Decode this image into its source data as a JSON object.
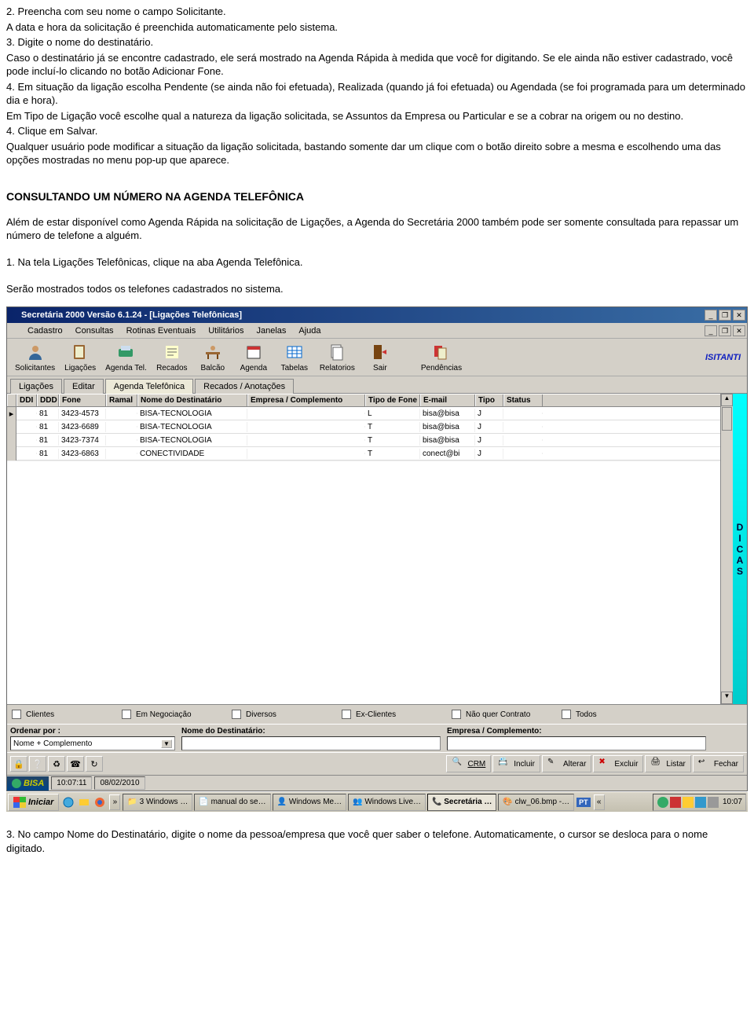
{
  "doc": {
    "p1": "2. Preencha com seu nome o campo Solicitante.",
    "p2": "A data e hora da solicitação é preenchida automaticamente pelo sistema.",
    "p3": "3. Digite o nome do destinatário.",
    "p4": "Caso o destinatário já se encontre cadastrado, ele será mostrado na Agenda Rápida à medida que você for digitando. Se ele ainda não estiver cadastrado, você pode incluí-lo clicando no botão Adicionar Fone.",
    "p5": "4. Em situação da ligação escolha Pendente (se ainda não foi efetuada), Realizada (quando já foi efetuada) ou Agendada (se foi programada para um determinado dia e hora).",
    "p6": "Em Tipo de Ligação você escolhe qual a natureza da ligação solicitada, se Assuntos da Empresa ou Particular e se a cobrar na origem ou no destino.",
    "p7": "4. Clique em Salvar.",
    "p8": "Qualquer usuário pode modificar a situação da ligação solicitada, bastando somente dar um clique com o botão direito sobre a mesma e escolhendo uma das opções mostradas no menu pop-up que aparece.",
    "heading": "CONSULTANDO UM NÚMERO NA AGENDA TELEFÔNICA",
    "p9": "Além de estar disponível como Agenda Rápida na solicitação de Ligações, a Agenda do Secretária 2000 também pode ser somente consultada para repassar um número de telefone a alguém.",
    "p10": "1. Na tela Ligações Telefônicas, clique na aba Agenda Telefônica.",
    "p11": "Serão mostrados todos os telefones cadastrados no sistema.",
    "p12": "3. No campo Nome do Destinatário, digite o nome da pessoa/empresa que você quer saber o telefone. Automaticamente, o cursor se desloca para o nome digitado."
  },
  "app": {
    "title": "Secretária 2000 Versão 6.1.24 - [Ligações Telefônicas]",
    "menus": [
      "Cadastro",
      "Consultas",
      "Rotinas Eventuais",
      "Utilitários",
      "Janelas",
      "Ajuda"
    ],
    "toolbar": [
      "Solicitantes",
      "Ligações",
      "Agenda Tel.",
      "Recados",
      "Balcão",
      "Agenda",
      "Tabelas",
      "Relatorios",
      "Sair",
      "Pendências"
    ],
    "marquee": "ISITANTI",
    "tabs": [
      "Ligações",
      "Editar",
      "Agenda Telefônica",
      "Recados / Anotações"
    ],
    "active_tab": 2,
    "grid": {
      "headers": [
        "DDI",
        "DDD",
        "Fone",
        "Ramal",
        "Nome do Destinatário",
        "Empresa / Complemento",
        "Tipo de Fone",
        "E-mail",
        "Tipo",
        "Status"
      ],
      "widths": [
        26,
        28,
        60,
        40,
        140,
        150,
        70,
        70,
        36,
        50
      ],
      "rows": [
        {
          "ddi": "",
          "ddd": "81",
          "fone": "3423-4573",
          "ramal": "",
          "nome": "BISA-TECNOLOGIA",
          "empresa": "",
          "tipofone": "L",
          "email": "bisa@bisa",
          "tipo": "J",
          "status": ""
        },
        {
          "ddi": "",
          "ddd": "81",
          "fone": "3423-6689",
          "ramal": "",
          "nome": "BISA-TECNOLOGIA",
          "empresa": "",
          "tipofone": "T",
          "email": "bisa@bisa",
          "tipo": "J",
          "status": ""
        },
        {
          "ddi": "",
          "ddd": "81",
          "fone": "3423-7374",
          "ramal": "",
          "nome": "BISA-TECNOLOGIA",
          "empresa": "",
          "tipofone": "T",
          "email": "bisa@bisa",
          "tipo": "J",
          "status": ""
        },
        {
          "ddi": "",
          "ddd": "81",
          "fone": "3423-6863",
          "ramal": "",
          "nome": "CONECTIVIDADE",
          "empresa": "",
          "tipofone": "T",
          "email": "conect@bi",
          "tipo": "J",
          "status": ""
        }
      ]
    },
    "dicas": "DICAS",
    "checks": [
      "Clientes",
      "Em Negociação",
      "Diversos",
      "Ex-Clientes",
      "Não quer Contrato",
      "Todos"
    ],
    "filters": {
      "ordenar_label": "Ordenar por :",
      "ordenar_value": "Nome + Complemento",
      "nome_label": "Nome do Destinatário:",
      "nome_value": "",
      "empresa_label": "Empresa / Complemento:",
      "empresa_value": ""
    },
    "buttons": {
      "crm": "CRM",
      "incluir": "Incluir",
      "alterar": "Alterar",
      "excluir": "Excluir",
      "listar": "Listar",
      "fechar": "Fechar"
    },
    "status": {
      "time": "10:07:11",
      "date": "08/02/2010",
      "bisa": "BISA"
    },
    "taskbar": {
      "start": "Iniciar",
      "items": [
        "3 Windows …",
        "manual do se…",
        "Windows Me…",
        "Windows Live…",
        "Secretária …",
        "clw_06.bmp -…"
      ],
      "pt": "PT",
      "clock": "10:07"
    }
  }
}
